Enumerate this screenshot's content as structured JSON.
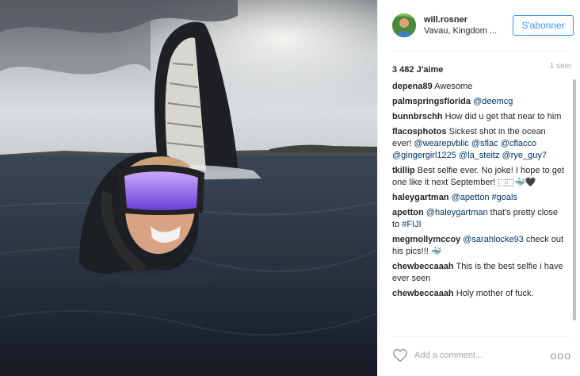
{
  "post": {
    "image_alt": "",
    "header": {
      "username": "will.rosner",
      "location": "Vavau, Kingdom ...",
      "follow_label": "S'abonner"
    },
    "likes": "3 482 J'aime",
    "time": "1 sem",
    "comments": [
      {
        "user": "",
        "parts": [
          {
            "t": "text",
            "v": "~ ~ ~ ~ ~ ~ ~"
          }
        ],
        "cut": true
      },
      {
        "user": "depena89",
        "parts": [
          {
            "t": "text",
            "v": " Awesome"
          }
        ]
      },
      {
        "user": "palmspringsflorida",
        "parts": [
          {
            "t": "text",
            "v": " "
          },
          {
            "t": "mention",
            "v": "@deemcg"
          }
        ]
      },
      {
        "user": "bunnbrschh",
        "parts": [
          {
            "t": "text",
            "v": " How did u get that near to him"
          }
        ]
      },
      {
        "user": "flacosphotos",
        "parts": [
          {
            "t": "text",
            "v": " Sickest shot in the ocean ever! "
          },
          {
            "t": "mention",
            "v": "@wearepvblic"
          },
          {
            "t": "text",
            "v": " "
          },
          {
            "t": "mention",
            "v": "@sflac"
          },
          {
            "t": "text",
            "v": " "
          },
          {
            "t": "mention",
            "v": "@cflacco"
          },
          {
            "t": "text",
            "v": " "
          },
          {
            "t": "mention",
            "v": "@gingergirl1225"
          },
          {
            "t": "text",
            "v": " "
          },
          {
            "t": "mention",
            "v": "@la_steitz"
          },
          {
            "t": "text",
            "v": " "
          },
          {
            "t": "mention",
            "v": "@rye_guy7"
          }
        ]
      },
      {
        "user": "tkillip",
        "parts": [
          {
            "t": "text",
            "v": " Best selfie ever. No joke! I hope to get one like it next September! ⬚⬚🐳🖤"
          }
        ]
      },
      {
        "user": "haleygartman",
        "parts": [
          {
            "t": "text",
            "v": " "
          },
          {
            "t": "mention",
            "v": "@apetton"
          },
          {
            "t": "text",
            "v": " "
          },
          {
            "t": "mention",
            "v": "#goals"
          }
        ]
      },
      {
        "user": "apetton",
        "parts": [
          {
            "t": "text",
            "v": " "
          },
          {
            "t": "mention",
            "v": "@haleygartman"
          },
          {
            "t": "text",
            "v": " that's pretty close to "
          },
          {
            "t": "mention",
            "v": "#FIJI"
          }
        ]
      },
      {
        "user": "megmollymccoy",
        "parts": [
          {
            "t": "text",
            "v": " "
          },
          {
            "t": "mention",
            "v": "@sarahlocke93"
          },
          {
            "t": "text",
            "v": " check out his pics!!! 🐳"
          }
        ]
      },
      {
        "user": "chewbeccaaah",
        "parts": [
          {
            "t": "text",
            "v": " This is the best selfie i have ever seen"
          }
        ]
      },
      {
        "user": "chewbeccaaah",
        "parts": [
          {
            "t": "text",
            "v": " Holy mother of fuck."
          }
        ]
      }
    ],
    "add_comment_placeholder": "Add a comment...",
    "more_label": "ooo",
    "icons": {
      "like": "heart-outline-icon",
      "more": "more-options-icon"
    },
    "colors": {
      "accent": "#3897f0",
      "mention": "#003569",
      "muted": "#a5a7aa"
    }
  }
}
